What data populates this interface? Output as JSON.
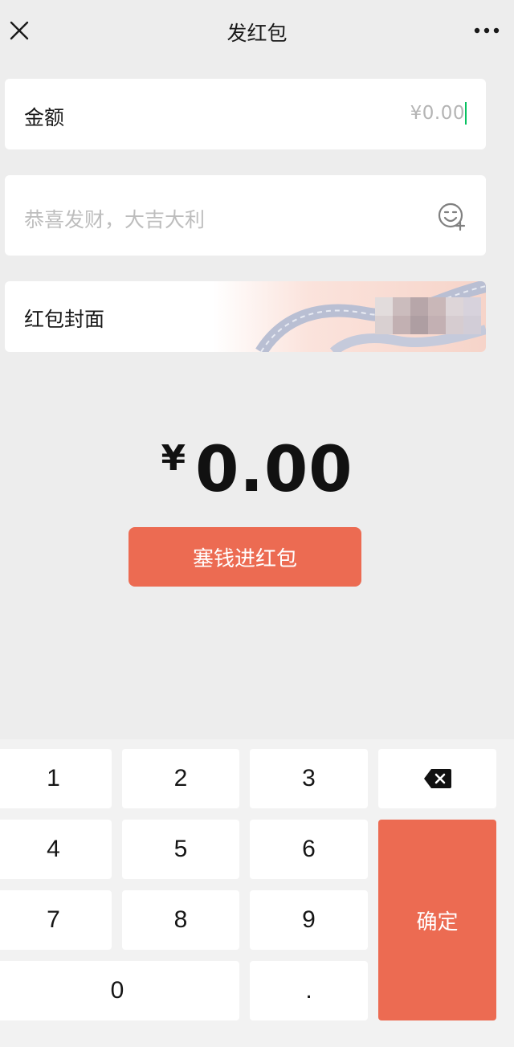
{
  "header": {
    "title": "发红包",
    "close_icon": "close-icon",
    "more_icon": "more-icon"
  },
  "amount": {
    "label": "金额",
    "value": "¥0.00"
  },
  "greeting": {
    "placeholder": "恭喜发财，大吉大利",
    "emoji_icon": "emoji-icon"
  },
  "cover": {
    "label": "红包封面"
  },
  "total": {
    "symbol": "¥",
    "amount": "0.00"
  },
  "submit": {
    "label": "塞钱进红包"
  },
  "keypad": {
    "keys": [
      "1",
      "2",
      "3",
      "4",
      "5",
      "6",
      "7",
      "8",
      "9",
      "0",
      "."
    ],
    "delete_icon": "backspace-icon",
    "confirm_label": "确定"
  },
  "colors": {
    "accent": "#ec6b52",
    "background": "#ededed",
    "caret": "#07c160"
  }
}
